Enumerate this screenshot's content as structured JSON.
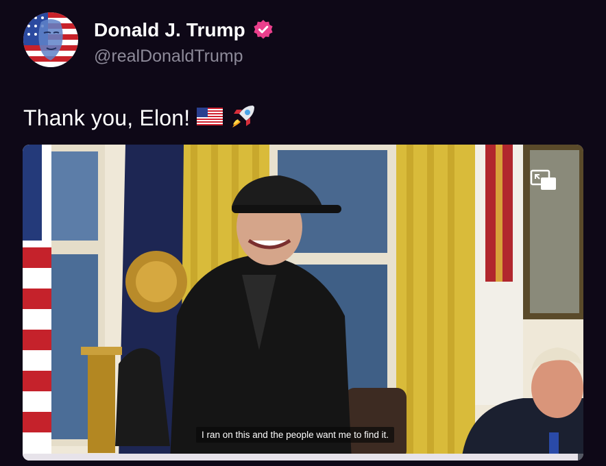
{
  "post": {
    "author": {
      "display_name": "Donald J. Trump",
      "handle": "@realDonaldTrump",
      "verified": true,
      "verified_color": "#ea3f8c"
    },
    "text": "Thank you, Elon!",
    "emojis": [
      "us-flag-emoji",
      "rocket-emoji"
    ],
    "media": {
      "type": "video",
      "caption": "I ran on this and the people want me to find it.",
      "progress": 0.99,
      "controls": {
        "pip_icon": "picture-in-picture-icon"
      }
    }
  },
  "colors": {
    "background": "#0e0817",
    "name": "#ffffff",
    "handle": "#8d8a99",
    "badge": "#ea3f8c"
  }
}
